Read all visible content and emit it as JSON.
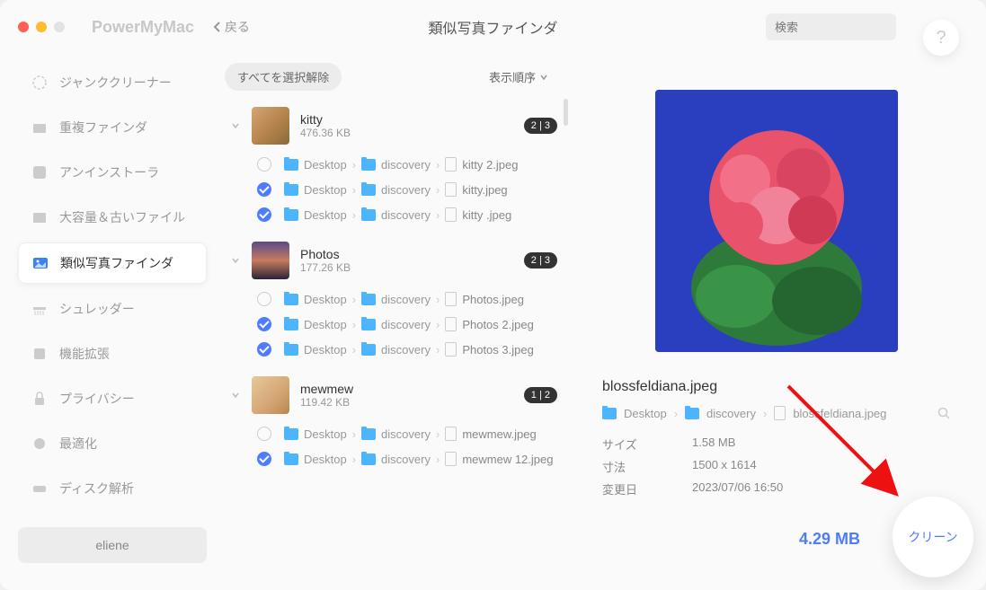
{
  "app": {
    "name": "PowerMyMac",
    "back": "戻る",
    "title": "類似写真ファインダ",
    "search_placeholder": "検索",
    "help": "?"
  },
  "sidebar": {
    "items": [
      {
        "label": "ジャンククリーナー"
      },
      {
        "label": "重複ファインダ"
      },
      {
        "label": "アンインストーラ"
      },
      {
        "label": "大容量＆古いファイル"
      },
      {
        "label": "類似写真ファインダ"
      },
      {
        "label": "シュレッダー"
      },
      {
        "label": "機能拡張"
      },
      {
        "label": "プライバシー"
      },
      {
        "label": "最適化"
      },
      {
        "label": "ディスク解析"
      }
    ],
    "user": "eliene"
  },
  "toolbar": {
    "deselect": "すべてを選択解除",
    "sort": "表示順序"
  },
  "groups": [
    {
      "name": "kitty",
      "size": "476.36 KB",
      "badge": "2 | 3",
      "files": [
        {
          "checked": false,
          "p1": "Desktop",
          "p2": "discovery",
          "fname": "kitty 2.jpeg"
        },
        {
          "checked": true,
          "p1": "Desktop",
          "p2": "discovery",
          "fname": "kitty.jpeg"
        },
        {
          "checked": true,
          "p1": "Desktop",
          "p2": "discovery",
          "fname": "kitty .jpeg"
        }
      ]
    },
    {
      "name": "Photos",
      "size": "177.26 KB",
      "badge": "2 | 3",
      "files": [
        {
          "checked": false,
          "p1": "Desktop",
          "p2": "discovery",
          "fname": "Photos.jpeg"
        },
        {
          "checked": true,
          "p1": "Desktop",
          "p2": "discovery",
          "fname": "Photos 2.jpeg"
        },
        {
          "checked": true,
          "p1": "Desktop",
          "p2": "discovery",
          "fname": "Photos 3.jpeg"
        }
      ]
    },
    {
      "name": "mewmew",
      "size": "119.42 KB",
      "badge": "1 | 2",
      "files": [
        {
          "checked": false,
          "p1": "Desktop",
          "p2": "discovery",
          "fname": "mewmew.jpeg"
        },
        {
          "checked": true,
          "p1": "Desktop",
          "p2": "discovery",
          "fname": "mewmew 12.jpeg"
        }
      ]
    }
  ],
  "preview": {
    "name": "blossfeldiana.jpeg",
    "path": {
      "p1": "Desktop",
      "p2": "discovery",
      "fname": "blossfeldiana.jpeg"
    },
    "meta": {
      "size_label": "サイズ",
      "size": "1.58 MB",
      "dim_label": "寸法",
      "dim": "1500 x 1614",
      "mod_label": "変更日",
      "mod": "2023/07/06 16:50"
    }
  },
  "footer": {
    "total": "4.29 MB",
    "clean": "クリーン"
  }
}
